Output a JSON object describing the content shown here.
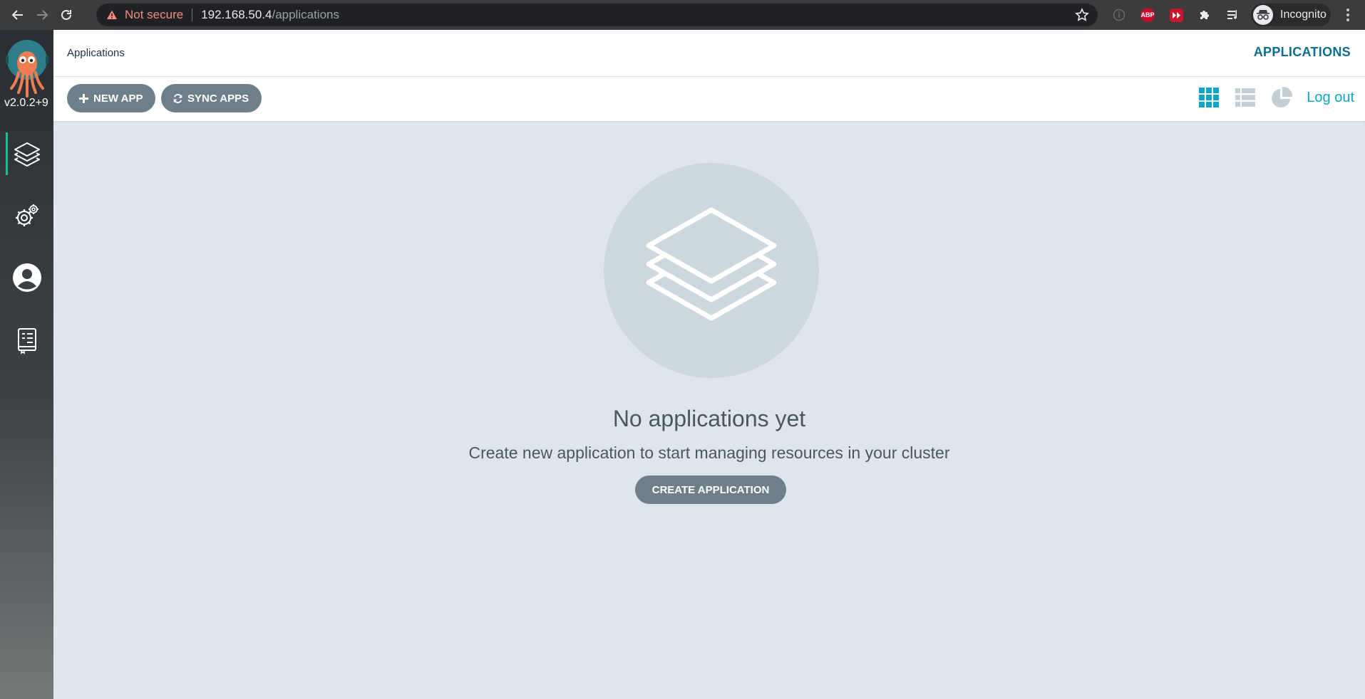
{
  "browser": {
    "security_label": "Not secure",
    "url_host": "192.168.50.4",
    "url_path": "/applications",
    "abp_label": "ABP",
    "profile_label": "Incognito"
  },
  "sidebar": {
    "version": "v2.0.2+9",
    "items": [
      {
        "name": "applications",
        "icon": "layers-icon",
        "active": true
      },
      {
        "name": "settings",
        "icon": "gears-icon"
      },
      {
        "name": "user-info",
        "icon": "user-icon"
      },
      {
        "name": "documentation",
        "icon": "docs-icon"
      }
    ]
  },
  "header": {
    "breadcrumb": "Applications",
    "title": "APPLICATIONS"
  },
  "toolbar": {
    "new_app_label": "NEW APP",
    "sync_apps_label": "SYNC APPS",
    "views": [
      "tiles-view-icon",
      "list-view-icon",
      "summary-view-icon"
    ],
    "logout_label": "Log out"
  },
  "empty_state": {
    "title": "No applications yet",
    "subtitle": "Create new application to start managing resources in your cluster",
    "button_label": "CREATE APPLICATION"
  },
  "colors": {
    "accent": "#10a5c4",
    "button": "#6d7f8b",
    "background": "#dee6eb",
    "header_title": "#0b6e8e"
  }
}
